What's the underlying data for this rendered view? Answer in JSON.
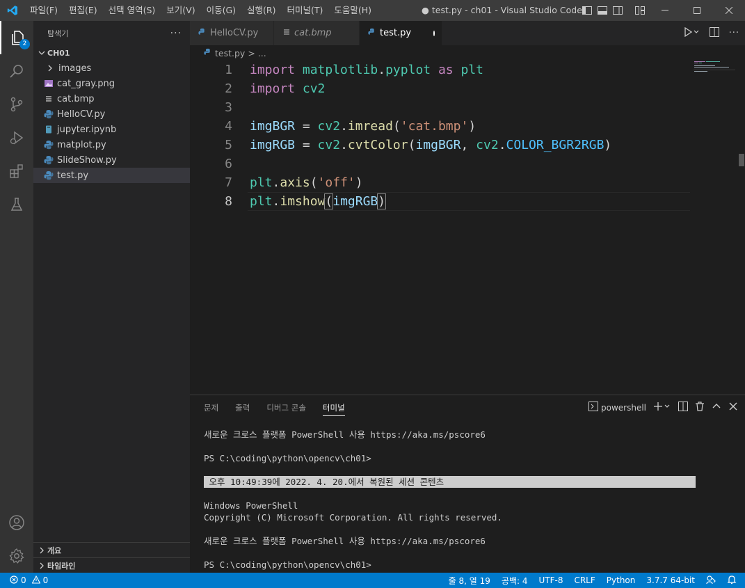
{
  "titlebar": {
    "menu": [
      "파일(F)",
      "편집(E)",
      "선택 영역(S)",
      "보기(V)",
      "이동(G)",
      "실행(R)",
      "터미널(T)",
      "도움말(H)"
    ],
    "window_title": "● test.py - ch01 - Visual Studio Code"
  },
  "activity": {
    "explorer_badge": "2"
  },
  "sidebar": {
    "title": "탐색기",
    "more": "···",
    "folder": "CH01",
    "items": [
      {
        "label": "images",
        "kind": "folder"
      },
      {
        "label": "cat_gray.png",
        "kind": "image"
      },
      {
        "label": "cat.bmp",
        "kind": "bmp"
      },
      {
        "label": "HelloCV.py",
        "kind": "python"
      },
      {
        "label": "jupyter.ipynb",
        "kind": "notebook"
      },
      {
        "label": "matplot.py",
        "kind": "python"
      },
      {
        "label": "SlideShow.py",
        "kind": "python"
      },
      {
        "label": "test.py",
        "kind": "python"
      }
    ],
    "outline": "개요",
    "timeline": "타임라인"
  },
  "tabs": [
    {
      "label": "HelloCV.py",
      "modified": true
    },
    {
      "label": "cat.bmp",
      "modified": false
    },
    {
      "label": "test.py",
      "modified": true
    }
  ],
  "breadcrumb": {
    "file": "test.py",
    "sep": "> ..."
  },
  "editor": {
    "line_numbers": [
      "1",
      "2",
      "3",
      "4",
      "5",
      "6",
      "7",
      "8"
    ],
    "lines": [
      "import matplotlib.pyplot as plt",
      "import cv2",
      "",
      "imgBGR = cv2.imread('cat.bmp')",
      "imgRGB = cv2.cvtColor(imgBGR, cv2.COLOR_BGR2RGB)",
      "",
      "plt.axis('off')",
      "plt.imshow(imgRGB)"
    ]
  },
  "panel": {
    "tabs": [
      "문제",
      "출력",
      "디버그 콘솔",
      "터미널"
    ],
    "shell": "powershell",
    "terminal": [
      "새로운 크로스 플랫폼 PowerShell 사용 https://aka.ms/pscore6",
      "",
      "PS C:\\coding\\python\\opencv\\ch01>",
      "",
      " 오후 10:49:39에 2022. 4. 20.에서 복원된 세션 콘텐츠",
      "",
      "Windows PowerShell",
      "Copyright (C) Microsoft Corporation. All rights reserved.",
      "",
      "새로운 크로스 플랫폼 PowerShell 사용 https://aka.ms/pscore6",
      "",
      "PS C:\\coding\\python\\opencv\\ch01>"
    ]
  },
  "status": {
    "errors": "0",
    "warnings": "0",
    "position": "줄 8, 열 19",
    "spaces": "공백: 4",
    "encoding": "UTF-8",
    "eol": "CRLF",
    "language": "Python",
    "interpreter": "3.7.7 64-bit"
  },
  "colors": {
    "accent": "#007acc",
    "editor_bg": "#1e1e1e",
    "sidebar_bg": "#252526"
  }
}
